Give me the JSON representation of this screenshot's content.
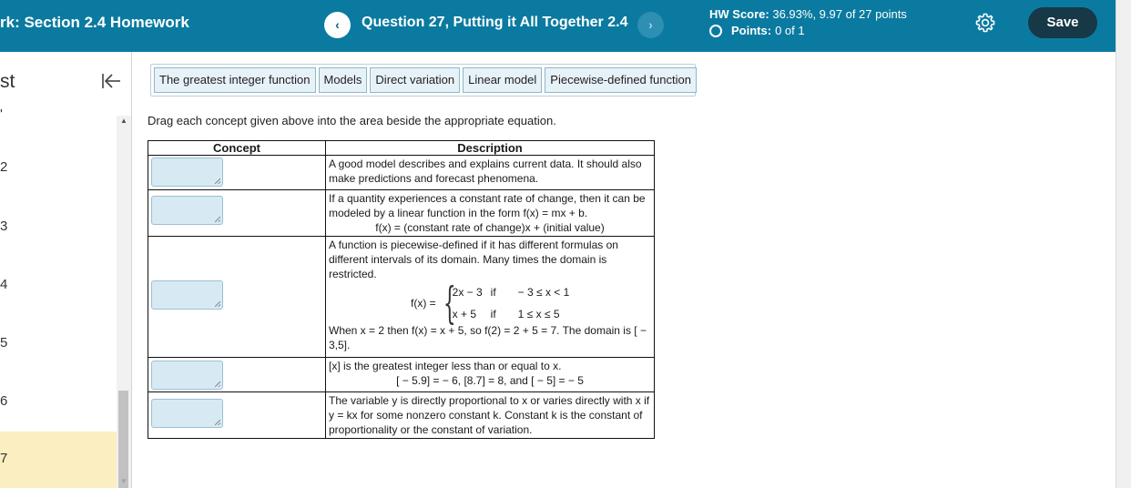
{
  "header": {
    "hw_title": "rk: Section 2.4 Homework",
    "question_title": "Question 27, Putting it All Together 2.4",
    "prev_label": "‹",
    "next_label": "›",
    "score_label": "HW Score:",
    "score_value": "36.93%, 9.97 of 27 points",
    "points_label": "Points:",
    "points_value": "0 of 1",
    "save_label": "Save"
  },
  "sidebar": {
    "list_title": "st",
    "items": [
      "'",
      "2",
      "3",
      "4",
      "5",
      "6",
      "7"
    ]
  },
  "concepts": [
    "The greatest integer function",
    "Models",
    "Direct variation",
    "Linear model",
    "Piecewise-defined function"
  ],
  "instructions": "Drag each concept given above into the area beside the appropriate equation.",
  "table": {
    "col_concept": "Concept",
    "col_description": "Description",
    "row1": "A good model describes and explains current data. It should also make predictions and forecast phenomena.",
    "row2_line1": "If a quantity experiences a constant rate of change, then it can be modeled by a linear function in the form f(x) = mx + b.",
    "row2_line2": "f(x) = (constant rate of change)x + (initial value)",
    "row3_text": "A function is piecewise-defined if it has different formulas on different intervals of its domain. Many times the domain is restricted.",
    "row3_fx": "f(x) =",
    "row3_case1_expr": "2x − 3",
    "row3_case1_if": "if",
    "row3_case1_cond": "− 3 ≤ x < 1",
    "row3_case2_expr": "x + 5",
    "row3_case2_if": "if",
    "row3_case2_cond": "1 ≤ x ≤ 5",
    "row3_example": "When x = 2 then f(x) = x + 5, so f(2) = 2 + 5 = 7. The domain is [ − 3,5].",
    "row4_line1": "[x] is the greatest integer less than or equal to x.",
    "row4_line2": "[ − 5.9] = − 6, [8.7] = 8, and [ − 5] = − 5",
    "row5": "The variable y is directly proportional to x or varies directly with x if y = kx for some nonzero constant k. Constant k is the constant of proportionality or the constant of variation."
  }
}
